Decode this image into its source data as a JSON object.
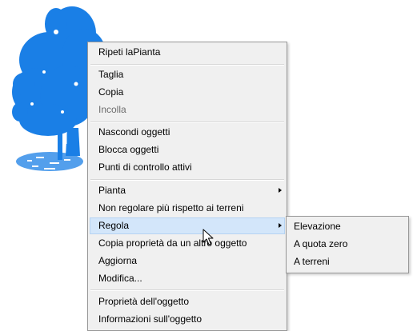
{
  "context_menu": {
    "items": [
      {
        "label": "Ripeti laPianta"
      },
      {
        "label": "Taglia"
      },
      {
        "label": "Copia"
      },
      {
        "label": "Incolla"
      },
      {
        "label": "Nascondi oggetti"
      },
      {
        "label": "Blocca oggetti"
      },
      {
        "label": "Punti di controllo attivi"
      },
      {
        "label": "Pianta"
      },
      {
        "label": "Non regolare più rispetto ai terreni"
      },
      {
        "label": "Regola"
      },
      {
        "label": "Copia proprietà da un altro oggetto"
      },
      {
        "label": "Aggiorna"
      },
      {
        "label": "Modifica..."
      },
      {
        "label": "Proprietà dell'oggetto"
      },
      {
        "label": "Informazioni sull'oggetto"
      }
    ]
  },
  "submenu": {
    "items": [
      {
        "label": "Elevazione"
      },
      {
        "label": "A quota zero"
      },
      {
        "label": "A terreni"
      }
    ]
  },
  "colors": {
    "menu_background": "#f0f0f0",
    "menu_border": "#979797",
    "highlight": "#d3e6fa",
    "highlight_border": "#b5d3f2",
    "disabled_text": "#6d6d6d",
    "tree_blue": "#1a7fe6"
  },
  "icons": {
    "submenu_arrow": "chevron-right-icon",
    "cursor": "mouse-pointer-icon",
    "tree": "tree-symbol-icon"
  }
}
